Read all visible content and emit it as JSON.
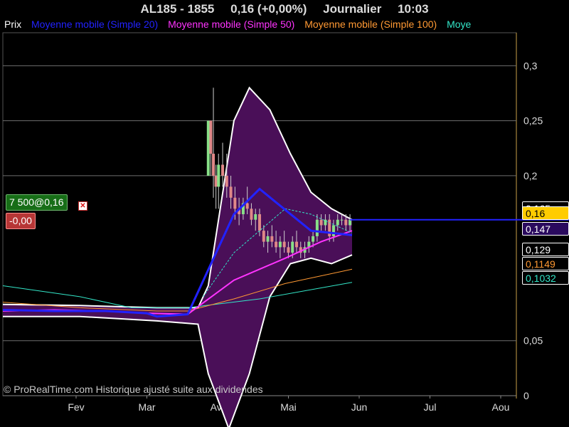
{
  "header": {
    "symbol": "AL185 - 1855",
    "quote": "0,16 (+0,00%)",
    "period": "Journalier",
    "time": "10:03"
  },
  "legend": {
    "items": [
      {
        "label": "Prix",
        "color": "#ffffff"
      },
      {
        "label": "Moyenne mobile (Simple 20)",
        "color": "#2222ff"
      },
      {
        "label": "Moyenne mobile (Simple 50)",
        "color": "#ff33ff"
      },
      {
        "label": "Moyenne mobile (Simple 100)",
        "color": "#ff9933"
      },
      {
        "label": "Moye",
        "color": "#33e6c8"
      }
    ]
  },
  "order_badge": {
    "text": "7 500@0,16",
    "color": "#176e17"
  },
  "pnl_badge": {
    "text": "-0,00",
    "color": "#b73636"
  },
  "price_labels": [
    {
      "text": "0,165",
      "color": "#ffffff",
      "bg": "#000000"
    },
    {
      "text": "0,16",
      "color": "#000000",
      "bg": "#ffcc00"
    },
    {
      "text": "0,147",
      "color": "#ffffff",
      "bg": "#2a0a5e"
    },
    {
      "text": "0,129",
      "color": "#ffffff",
      "bg": "#000000"
    },
    {
      "text": "0,1149",
      "color": "#ff9933",
      "bg": "#000000"
    },
    {
      "text": "0,1032",
      "color": "#33e6c8",
      "bg": "#000000"
    }
  ],
  "copyright": "© ProRealTime.com Historique ajusté suite aux dividendes",
  "chart_data": {
    "type": "line",
    "y_ticks": [
      {
        "value": 0.3,
        "label": "0,3"
      },
      {
        "value": 0.25,
        "label": "0,25"
      },
      {
        "value": 0.2,
        "label": "0,2"
      },
      {
        "value": 0.05,
        "label": "0,05"
      },
      {
        "value": 0,
        "label": "0"
      }
    ],
    "x_ticks": [
      "Fev",
      "Mar",
      "Avr",
      "Mai",
      "Jun",
      "Jul",
      "Aou"
    ],
    "ylim": [
      0,
      0.33
    ],
    "grid": true,
    "current_price": 0.16,
    "colors": {
      "band_fill": "#4a0f58",
      "band_edge": "#ffffff",
      "up": "#88e088",
      "down": "#e08888",
      "ma20": "#2222ff",
      "ma50": "#ff33ff",
      "ma100": "#ff9933",
      "ma200": "#33e6c8",
      "grid": "#6e6e6e",
      "price_line": "#2222ff"
    },
    "ma20": [
      [
        0,
        0.078
      ],
      [
        0.1,
        0.077
      ],
      [
        0.2,
        0.077
      ],
      [
        0.28,
        0.075
      ],
      [
        0.3,
        0.072
      ],
      [
        0.36,
        0.074
      ],
      [
        0.45,
        0.165
      ],
      [
        0.5,
        0.188
      ],
      [
        0.6,
        0.15
      ],
      [
        0.68,
        0.146
      ]
    ],
    "ma50": [
      [
        0,
        0.077
      ],
      [
        0.1,
        0.078
      ],
      [
        0.2,
        0.077
      ],
      [
        0.28,
        0.075
      ],
      [
        0.36,
        0.074
      ],
      [
        0.45,
        0.105
      ],
      [
        0.55,
        0.125
      ],
      [
        0.62,
        0.14
      ],
      [
        0.68,
        0.15
      ]
    ],
    "ma100": [
      [
        0,
        0.085
      ],
      [
        0.15,
        0.08
      ],
      [
        0.3,
        0.077
      ],
      [
        0.36,
        0.077
      ],
      [
        0.45,
        0.088
      ],
      [
        0.55,
        0.102
      ],
      [
        0.68,
        0.115
      ]
    ],
    "ma200": [
      [
        0,
        0.1
      ],
      [
        0.15,
        0.09
      ],
      [
        0.25,
        0.08
      ],
      [
        0.36,
        0.08
      ],
      [
        0.5,
        0.088
      ],
      [
        0.68,
        0.103
      ]
    ],
    "ma_dashed": [
      [
        0.39,
        0.09
      ],
      [
        0.45,
        0.13
      ],
      [
        0.55,
        0.17
      ],
      [
        0.6,
        0.165
      ],
      [
        0.68,
        0.148
      ]
    ],
    "band_upper": [
      [
        0,
        0.083
      ],
      [
        0.15,
        0.082
      ],
      [
        0.3,
        0.08
      ],
      [
        0.38,
        0.08
      ],
      [
        0.4,
        0.1
      ],
      [
        0.45,
        0.25
      ],
      [
        0.48,
        0.28
      ],
      [
        0.52,
        0.26
      ],
      [
        0.56,
        0.22
      ],
      [
        0.6,
        0.185
      ],
      [
        0.64,
        0.17
      ],
      [
        0.68,
        0.16
      ]
    ],
    "band_lower": [
      [
        0,
        0.072
      ],
      [
        0.15,
        0.072
      ],
      [
        0.3,
        0.068
      ],
      [
        0.38,
        0.065
      ],
      [
        0.4,
        0.02
      ],
      [
        0.44,
        -0.03
      ],
      [
        0.48,
        0.02
      ],
      [
        0.52,
        0.09
      ],
      [
        0.56,
        0.12
      ],
      [
        0.6,
        0.125
      ],
      [
        0.64,
        0.12
      ],
      [
        0.68,
        0.128
      ]
    ],
    "candles": [
      [
        0.4,
        0.2,
        0.25,
        0.2,
        0.25
      ],
      [
        0.405,
        0.25,
        0.25,
        0.2,
        0.22
      ],
      [
        0.41,
        0.22,
        0.28,
        0.18,
        0.2
      ],
      [
        0.415,
        0.2,
        0.21,
        0.17,
        0.19
      ],
      [
        0.42,
        0.19,
        0.22,
        0.17,
        0.21
      ],
      [
        0.428,
        0.21,
        0.23,
        0.19,
        0.2
      ],
      [
        0.436,
        0.2,
        0.22,
        0.18,
        0.19
      ],
      [
        0.444,
        0.19,
        0.2,
        0.17,
        0.18
      ],
      [
        0.452,
        0.18,
        0.19,
        0.16,
        0.17
      ],
      [
        0.46,
        0.17,
        0.18,
        0.155,
        0.165
      ],
      [
        0.468,
        0.165,
        0.18,
        0.16,
        0.175
      ],
      [
        0.476,
        0.175,
        0.19,
        0.165,
        0.17
      ],
      [
        0.484,
        0.17,
        0.175,
        0.155,
        0.16
      ],
      [
        0.492,
        0.16,
        0.17,
        0.15,
        0.165
      ],
      [
        0.5,
        0.165,
        0.17,
        0.145,
        0.15
      ],
      [
        0.508,
        0.15,
        0.155,
        0.135,
        0.14
      ],
      [
        0.516,
        0.14,
        0.15,
        0.13,
        0.145
      ],
      [
        0.524,
        0.145,
        0.155,
        0.135,
        0.14
      ],
      [
        0.532,
        0.14,
        0.15,
        0.13,
        0.135
      ],
      [
        0.54,
        0.135,
        0.145,
        0.125,
        0.14
      ],
      [
        0.548,
        0.14,
        0.15,
        0.13,
        0.135
      ],
      [
        0.556,
        0.135,
        0.14,
        0.125,
        0.13
      ],
      [
        0.564,
        0.13,
        0.145,
        0.125,
        0.14
      ],
      [
        0.572,
        0.14,
        0.15,
        0.13,
        0.135
      ],
      [
        0.58,
        0.135,
        0.14,
        0.125,
        0.13
      ],
      [
        0.588,
        0.13,
        0.14,
        0.125,
        0.135
      ],
      [
        0.596,
        0.135,
        0.145,
        0.13,
        0.14
      ],
      [
        0.604,
        0.14,
        0.15,
        0.135,
        0.145
      ],
      [
        0.612,
        0.145,
        0.165,
        0.14,
        0.16
      ],
      [
        0.62,
        0.16,
        0.165,
        0.15,
        0.155
      ],
      [
        0.628,
        0.155,
        0.165,
        0.15,
        0.16
      ],
      [
        0.636,
        0.16,
        0.165,
        0.14,
        0.145
      ],
      [
        0.644,
        0.145,
        0.16,
        0.14,
        0.155
      ],
      [
        0.652,
        0.155,
        0.165,
        0.15,
        0.16
      ],
      [
        0.66,
        0.16,
        0.165,
        0.155,
        0.16
      ],
      [
        0.668,
        0.16,
        0.165,
        0.15,
        0.155
      ],
      [
        0.676,
        0.155,
        0.165,
        0.15,
        0.16
      ]
    ]
  }
}
